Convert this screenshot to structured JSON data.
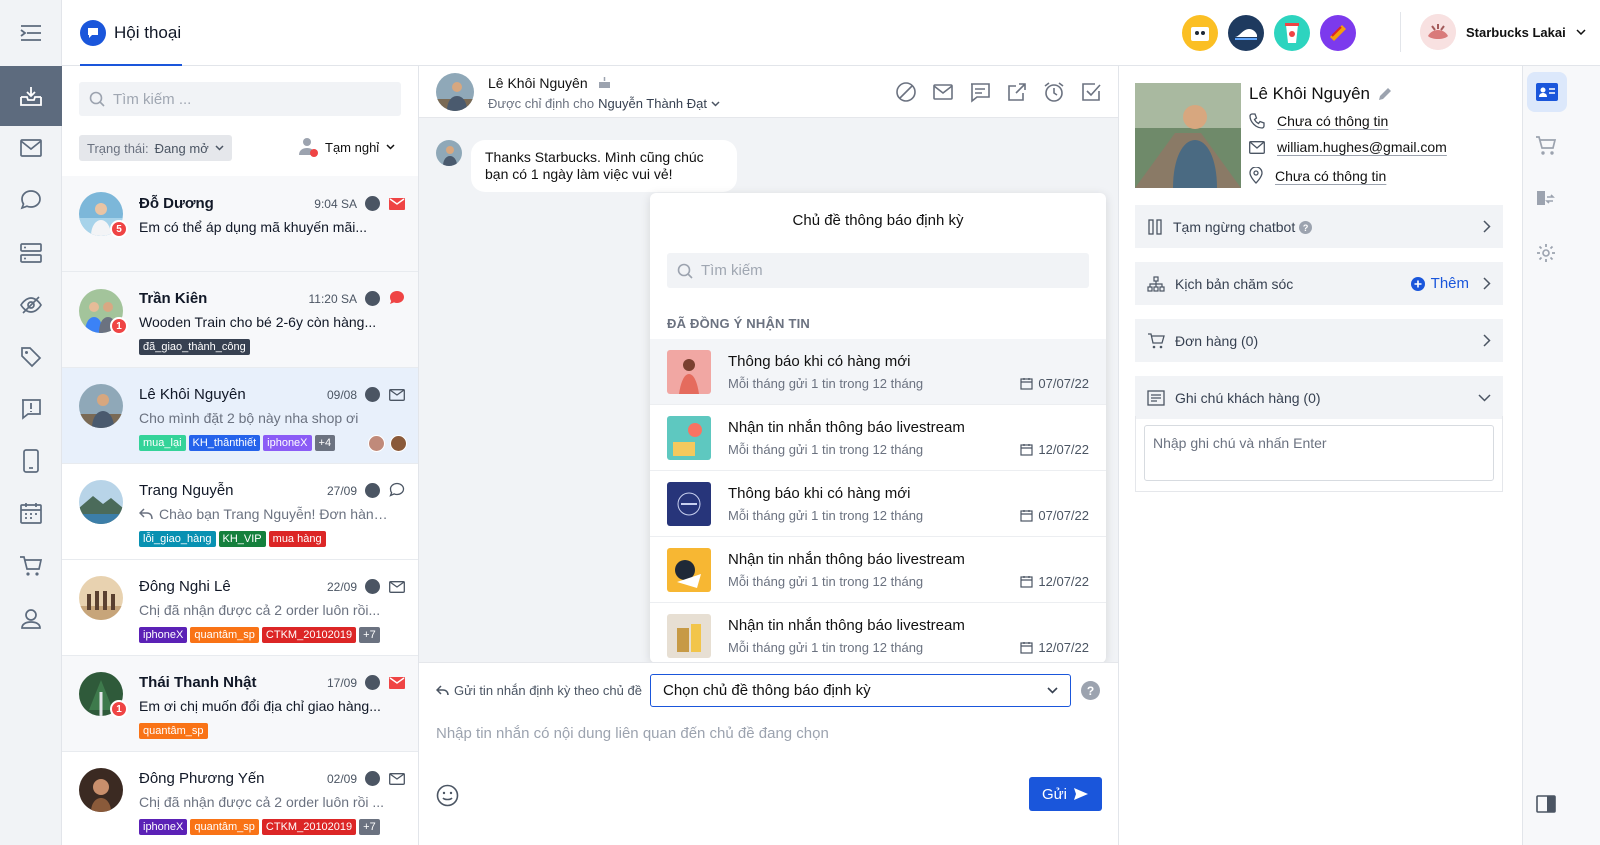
{
  "header": {
    "tab_label": "Hội thoại",
    "account_name": "Starbucks Lakai"
  },
  "list": {
    "search_placeholder": "Tìm kiếm ...",
    "filter_label": "Trạng thái:",
    "filter_value": "Đang mở",
    "away_label": "Tạm nghỉ",
    "conversations": [
      {
        "name": "Đỗ Dương",
        "time": "9:04 SA",
        "message": "Em có thể áp dụng mã khuyến mãi...",
        "unread": "5",
        "channel": "mail-icon",
        "tags": [],
        "more": ""
      },
      {
        "name": "Trần Kiên",
        "time": "11:20 SA",
        "message": "Wooden Train cho bé 2-6y còn hàng...",
        "unread": "1",
        "channel": "chat-icon",
        "tags": [
          {
            "label": "đã_giao_thành_công",
            "color": "#374151"
          }
        ],
        "more": ""
      },
      {
        "name": "Lê Khôi Nguyên",
        "time": "09/08",
        "message": "Cho mình đặt 2 bộ này nha shop ơi",
        "unread": "",
        "channel": "mail-outline-icon",
        "tags": [
          {
            "label": "mua_lại",
            "color": "#34d399"
          },
          {
            "label": "KH_thânthiết",
            "color": "#2563eb"
          },
          {
            "label": "iphoneX",
            "color": "#8b5cf6"
          }
        ],
        "more": "+4"
      },
      {
        "name": "Trang Nguyễn",
        "time": "27/09",
        "message": "Chào bạn Trang Nguyễn! Đơn hàng...",
        "unread": "",
        "channel": "chat-outline-icon",
        "tags": [
          {
            "label": "lỗi_giao_hàng",
            "color": "#0891b2"
          },
          {
            "label": "KH_VIP",
            "color": "#15803d"
          },
          {
            "label": "mua hàng",
            "color": "#dc2626"
          }
        ],
        "more": ""
      },
      {
        "name": "Đông Nghi Lê",
        "time": "22/09",
        "message": "Chị đã nhận được cả 2 order luôn rồi...",
        "unread": "",
        "channel": "mail-outline-icon",
        "tags": [
          {
            "label": "iphoneX",
            "color": "#5b21b6"
          },
          {
            "label": "quantâm_sp",
            "color": "#f97316"
          },
          {
            "label": "CTKM_20102019",
            "color": "#dc2626"
          }
        ],
        "more": "+7"
      },
      {
        "name": "Thái Thanh Nhật",
        "time": "17/09",
        "message": "Em ơi chị muốn đổi địa chỉ giao hàng...",
        "unread": "1",
        "channel": "mail-icon",
        "tags": [
          {
            "label": "quantâm_sp",
            "color": "#f97316"
          }
        ],
        "more": ""
      },
      {
        "name": "Đông Phương Yến",
        "time": "02/09",
        "message": "Chị đã nhận được cả 2 order luôn rồi ...",
        "unread": "",
        "channel": "mail-outline-icon",
        "tags": [
          {
            "label": "iphoneX",
            "color": "#5b21b6"
          },
          {
            "label": "quantâm_sp",
            "color": "#f97316"
          },
          {
            "label": "CTKM_20102019",
            "color": "#dc2626"
          }
        ],
        "more": "+7"
      }
    ]
  },
  "conversation": {
    "contact_name": "Lê Khôi Nguyên",
    "assigned_prefix": "Được chỉ định cho",
    "assignee": "Nguyễn Thành Đạt",
    "incoming_message": "Thanks Starbucks. Mình cũng chúc bạn có 1 ngày làm việc vui vẻ!",
    "popup": {
      "title": "Chủ đề thông báo định kỳ",
      "search_placeholder": "Tìm kiếm",
      "section": "ĐÃ ĐỒNG Ý NHẬN TIN",
      "items": [
        {
          "title": "Thông báo khi có hàng mới",
          "subtitle": "Mỗi tháng gửi 1 tin trong 12 tháng",
          "date": "07/07/22"
        },
        {
          "title": "Nhận tin nhắn thông báo livestream",
          "subtitle": "Mỗi tháng gửi 1 tin trong 12 tháng",
          "date": "12/07/22"
        },
        {
          "title": "Thông báo khi có hàng mới",
          "subtitle": "Mỗi tháng gửi 1 tin trong 12 tháng",
          "date": "07/07/22"
        },
        {
          "title": "Nhận tin nhắn thông báo livestream",
          "subtitle": "Mỗi tháng gửi 1 tin trong 12 tháng",
          "date": "12/07/22"
        },
        {
          "title": "Nhận tin nhắn thông báo livestream",
          "subtitle": "Mỗi tháng gửi 1 tin trong 12 tháng",
          "date": "12/07/22"
        }
      ]
    },
    "composer": {
      "mode_label": "Gửi tin nhắn định kỳ theo chủ đề",
      "topic_select": "Chọn chủ đề thông báo định kỳ",
      "placeholder": "Nhập tin nhắn có nội dung liên quan đến chủ đề đang chọn",
      "send_label": "Gửi",
      "help": "?"
    }
  },
  "customer": {
    "name": "Lê Khôi Nguyên",
    "phone": "Chưa có thông tin",
    "email": "william.hughes@gmail.com",
    "address": "Chưa có thông tin",
    "pause_chatbot": "Tạm ngừng chatbot",
    "care_script": "Kịch bản chăm sóc",
    "add_label": "Thêm",
    "orders": "Đơn hàng (0)",
    "notes": "Ghi chú khách hàng (0)",
    "note_placeholder": "Nhập ghi chú và nhấn Enter"
  },
  "colors": {
    "accent": "#1a56db",
    "nav_active": "#5d6b7e",
    "badge": "#ef4444"
  }
}
